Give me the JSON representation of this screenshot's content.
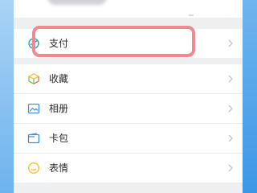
{
  "menu": {
    "items": [
      {
        "label": "支付",
        "icon": "wechat-pay-icon"
      },
      {
        "label": "收藏",
        "icon": "favorites-cube-icon"
      },
      {
        "label": "相册",
        "icon": "album-icon"
      },
      {
        "label": "卡包",
        "icon": "card-wallet-icon"
      },
      {
        "label": "表情",
        "icon": "sticker-smile-icon"
      }
    ]
  },
  "colors": {
    "accent_highlight": "#f08a8f",
    "pay_icon": "#31a0b4",
    "favorites_icon_top": "#f4c243",
    "favorites_icon_side": "#7fc06a",
    "album_icon": "#4c8fd3",
    "card_icon": "#3b8fd6",
    "sticker_icon": "#f3c23b"
  }
}
